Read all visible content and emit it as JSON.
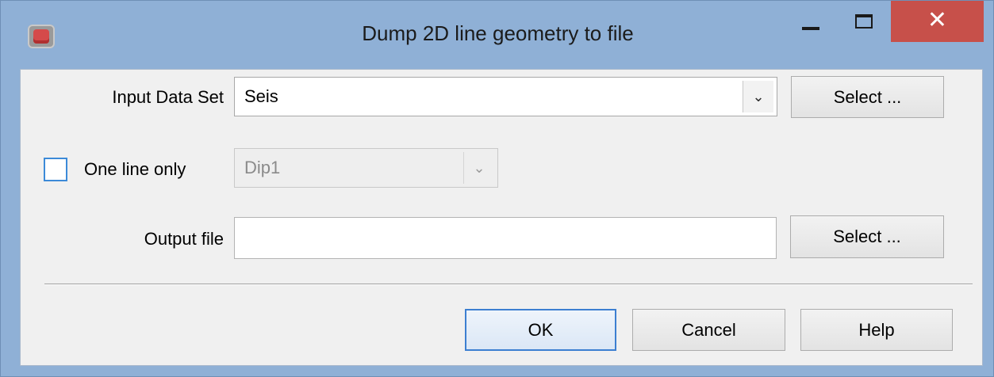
{
  "window": {
    "title": "Dump 2D line geometry to file",
    "close_glyph": "✕",
    "icons": [
      "app-icon",
      "minimize-icon",
      "maximize-icon",
      "close-icon"
    ]
  },
  "input_data_set": {
    "label": "Input Data Set",
    "value": "Seis",
    "select_label": "Select ..."
  },
  "one_line_only": {
    "label": "One line only",
    "checked": false,
    "value": "Dip1"
  },
  "output_file": {
    "label": "Output file",
    "value": "",
    "select_label": "Select ..."
  },
  "buttons": {
    "ok": "OK",
    "cancel": "Cancel",
    "help": "Help"
  },
  "colors": {
    "frame": "#8fb0d6",
    "close_button": "#c7504a",
    "client_bg": "#f0f0f0",
    "focus_accent": "#3c7fd1"
  }
}
